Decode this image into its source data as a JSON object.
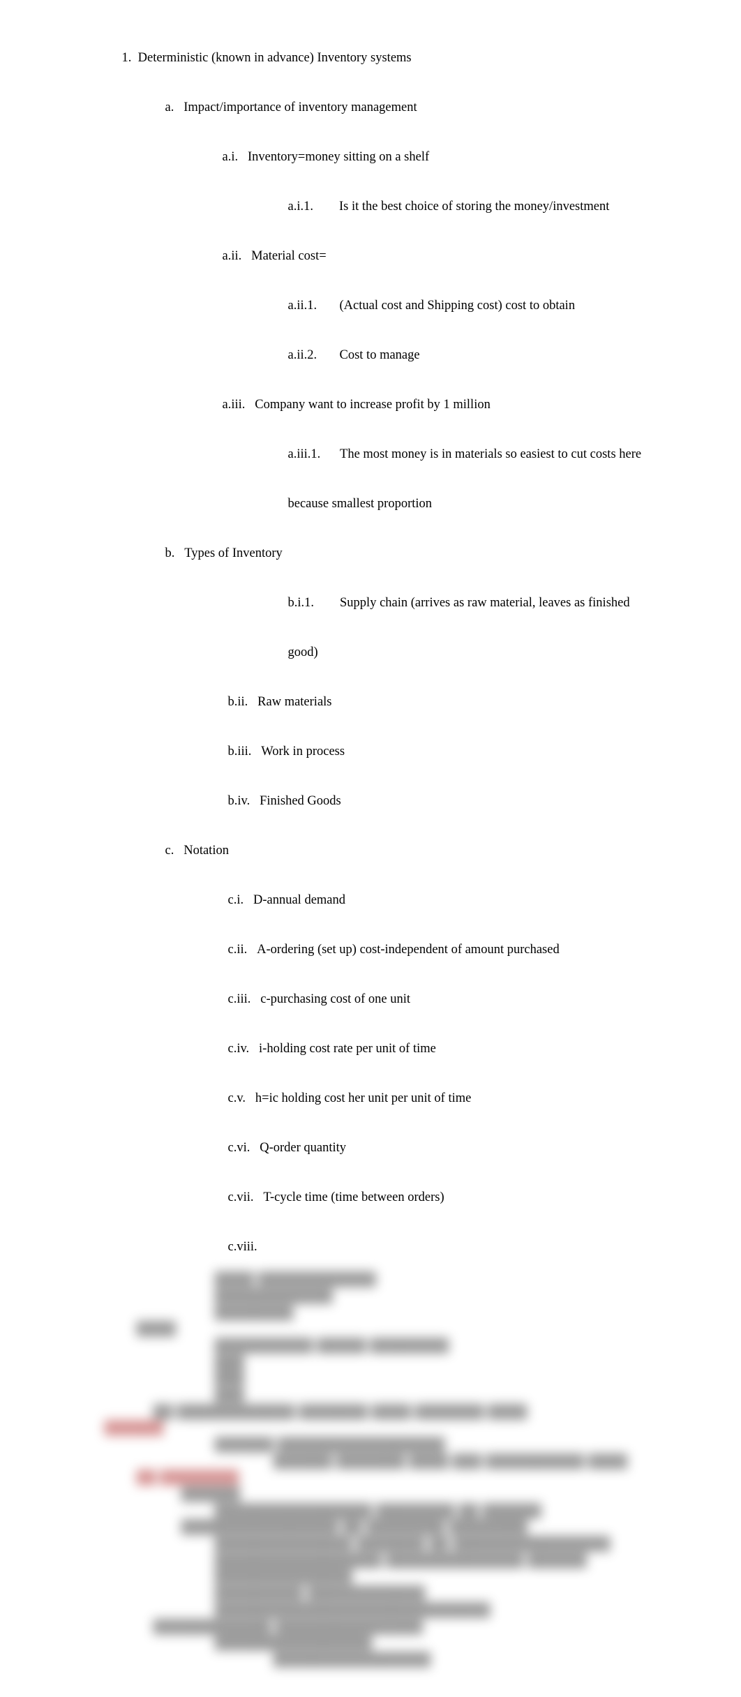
{
  "doc": {
    "l1_num": "1.",
    "l1_text": "Deterministic (known in advance) Inventory systems",
    "a": {
      "num": "a.",
      "text": "Impact/importance of inventory management",
      "i": {
        "num": "a.i.",
        "text": "Inventory=money sitting on a shelf",
        "1": {
          "num": "a.i.1.",
          "text": "Is it the best choice of storing the money/investment"
        }
      },
      "ii": {
        "num": "a.ii.",
        "text": "Material cost=",
        "1": {
          "num": "a.ii.1.",
          "text": "(Actual cost and Shipping cost) cost to obtain"
        },
        "2": {
          "num": "a.ii.2.",
          "text": "Cost to manage"
        }
      },
      "iii": {
        "num": "a.iii.",
        "text": "Company want to increase profit by 1 million",
        "1": {
          "num": "a.iii.1.",
          "text": "The most money is in materials so easiest to cut costs here",
          "cont": "because smallest proportion"
        }
      }
    },
    "b": {
      "num": "b.",
      "text": "Types of Inventory",
      "i1": {
        "num": "b.i.1.",
        "text": "Supply chain (arrives as raw material, leaves as finished",
        "cont": "good)"
      },
      "ii": {
        "num": "b.ii.",
        "text": "Raw materials"
      },
      "iii": {
        "num": "b.iii.",
        "text": "Work in process"
      },
      "iv": {
        "num": "b.iv.",
        "text": "Finished Goods"
      }
    },
    "c": {
      "num": "c.",
      "text": "Notation",
      "i": {
        "num": "c.i.",
        "text": "D-annual demand"
      },
      "ii": {
        "num": "c.ii.",
        "text": "A-ordering (set up) cost-independent of amount purchased"
      },
      "iii": {
        "num": "c.iii.",
        "text": "c-purchasing cost of one unit"
      },
      "iv": {
        "num": "c.iv.",
        "text": "i-holding cost rate per unit of time"
      },
      "v": {
        "num": "c.v.",
        "text": "h=ic holding cost her unit per unit of time"
      },
      "vi": {
        "num": "c.vi.",
        "text": "Q-order quantity"
      },
      "vii": {
        "num": "c.vii.",
        "text": "T-cycle time (time between orders)"
      },
      "viii": {
        "num": "c.viii."
      }
    }
  },
  "blur": {
    "lines": [
      "████ ████████████",
      "████████████",
      "████████",
      "████",
      "██████████ █████ ████████",
      "███",
      "███",
      "███",
      "██ ████████████ ███████ ████ ███████ ████",
      "██████",
      "██████ █████████████████",
      "██████ ███████ ████ ███ ██████████ ████",
      "██ ████████",
      "██████",
      "████████████████ ████████ ██ ██████",
      "████████████████ ██ ████████ ████████",
      "██████████████ ███████ ██ ████████████████",
      "█████████████████ ██████████████ ██████ ██████████████",
      "█████████ ████████████ ████████████████████████████",
      "████████████ ███████████████",
      "████████████████",
      "████████████████"
    ]
  }
}
